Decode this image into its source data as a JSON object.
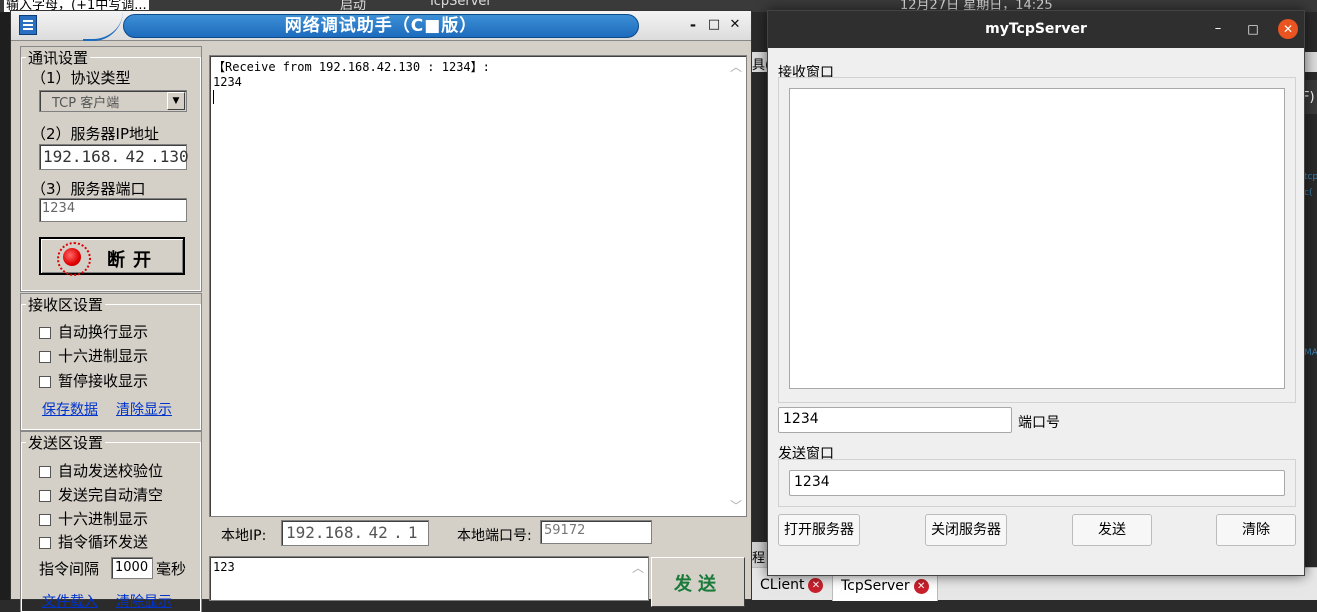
{
  "desktop": {
    "top_left": "输入字母，(+1中写调...",
    "top_mid_1": "启动",
    "top_mid_2": "TcpServer",
    "top_clock": "12月27日 星期日，14:25",
    "ide_fragment_1": "具(",
    "ide_fragment_2": "程",
    "ide_right_1": "F)",
    "ide_right_2": "tcp",
    "ide_right_3": "c(",
    "ide_right_4": "MAT",
    "ide_tabs": [
      {
        "label": "CLient",
        "close_glyph": "✕"
      },
      {
        "label": "TcpServer",
        "close_glyph": "✕"
      }
    ]
  },
  "netassist": {
    "title": "网络调试助手（C■版）",
    "window_buttons": {
      "minimize": "-",
      "maximize": "□",
      "close": "✕"
    },
    "comm": {
      "group_title": "通讯设置",
      "protocol_label": "（1）协议类型",
      "protocol_value": "TCP 客户端",
      "server_ip_label": "（2）服务器IP地址",
      "server_ip": [
        "192",
        "168",
        "42",
        "130"
      ],
      "server_port_label": "（3）服务器端口",
      "server_port": "1234",
      "disconnect_label": "断开"
    },
    "recv_settings": {
      "group_title": "接收区设置",
      "options": [
        "自动换行显示",
        "十六进制显示",
        "暂停接收显示"
      ],
      "save_link": "保存数据",
      "clear_link": "清除显示"
    },
    "send_settings": {
      "group_title": "发送区设置",
      "options": [
        "自动发送校验位",
        "发送完自动清空",
        "十六进制显示",
        "指令循环发送"
      ],
      "interval_label": "指令间隔",
      "interval_value": "1000",
      "interval_unit": "毫秒",
      "file_link": "文件载入",
      "clear_link": "清除显示"
    },
    "receive_text": [
      "【Receive from 192.168.42.130 : 1234】:",
      "1234"
    ],
    "local_ip_label": "本地IP:",
    "local_ip": [
      "192",
      "168",
      "42",
      "1"
    ],
    "local_port_label": "本地端口号:",
    "local_port": "59172",
    "send_text": "123",
    "send_button": "发送"
  },
  "server": {
    "title": "myTcpServer",
    "window_buttons": {
      "minimize": "–",
      "maximize": "□",
      "close": "✕"
    },
    "recv_label": "接收窗口",
    "port_value": "1234",
    "port_label": "端口号",
    "send_label": "发送窗口",
    "send_value": "1234",
    "buttons": {
      "open": "打开服务器",
      "close": "关闭服务器",
      "send": "发送",
      "clear": "清除"
    }
  },
  "colors": {
    "title_bar_blue": "#1d6bbd",
    "server_title_bar": "#2f2f2f",
    "ubuntu_close": "#e95420",
    "send_green": "#1a7a3a",
    "link_blue": "#0033cc"
  }
}
